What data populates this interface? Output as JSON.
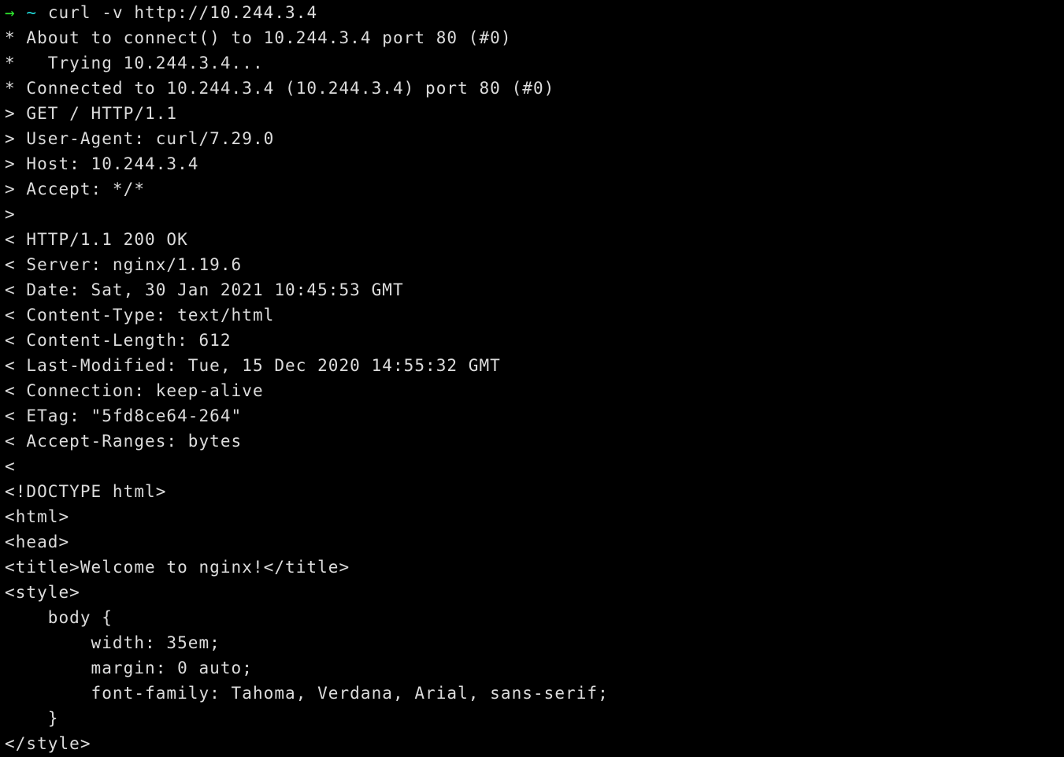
{
  "terminal": {
    "background_color": "#000000",
    "foreground_color": "#dcdcdc",
    "prompt": {
      "arrow_glyph": "→",
      "arrow_color": "#2ee62e",
      "cwd_glyph": "~",
      "cwd_color": "#1fd6d6",
      "command": "curl -v http://10.244.3.4"
    },
    "lines": [
      {
        "kind": "prompt"
      },
      {
        "kind": "output",
        "text": "* About to connect() to 10.244.3.4 port 80 (#0)"
      },
      {
        "kind": "output",
        "text": "*   Trying 10.244.3.4..."
      },
      {
        "kind": "output",
        "text": "* Connected to 10.244.3.4 (10.244.3.4) port 80 (#0)"
      },
      {
        "kind": "output",
        "text": "> GET / HTTP/1.1"
      },
      {
        "kind": "output",
        "text": "> User-Agent: curl/7.29.0"
      },
      {
        "kind": "output",
        "text": "> Host: 10.244.3.4"
      },
      {
        "kind": "output",
        "text": "> Accept: */*"
      },
      {
        "kind": "output",
        "text": ">"
      },
      {
        "kind": "output",
        "text": "< HTTP/1.1 200 OK"
      },
      {
        "kind": "output",
        "text": "< Server: nginx/1.19.6"
      },
      {
        "kind": "output",
        "text": "< Date: Sat, 30 Jan 2021 10:45:53 GMT"
      },
      {
        "kind": "output",
        "text": "< Content-Type: text/html"
      },
      {
        "kind": "output",
        "text": "< Content-Length: 612"
      },
      {
        "kind": "output",
        "text": "< Last-Modified: Tue, 15 Dec 2020 14:55:32 GMT"
      },
      {
        "kind": "output",
        "text": "< Connection: keep-alive"
      },
      {
        "kind": "output",
        "text": "< ETag: \"5fd8ce64-264\""
      },
      {
        "kind": "output",
        "text": "< Accept-Ranges: bytes"
      },
      {
        "kind": "output",
        "text": "<"
      },
      {
        "kind": "output",
        "text": "<!DOCTYPE html>"
      },
      {
        "kind": "output",
        "text": "<html>"
      },
      {
        "kind": "output",
        "text": "<head>"
      },
      {
        "kind": "output",
        "text": "<title>Welcome to nginx!</title>"
      },
      {
        "kind": "output",
        "text": "<style>"
      },
      {
        "kind": "output",
        "text": "    body {"
      },
      {
        "kind": "output",
        "text": "        width: 35em;"
      },
      {
        "kind": "output",
        "text": "        margin: 0 auto;"
      },
      {
        "kind": "output",
        "text": "        font-family: Tahoma, Verdana, Arial, sans-serif;"
      },
      {
        "kind": "output",
        "text": "    }"
      },
      {
        "kind": "output",
        "text": "</style>"
      }
    ]
  }
}
